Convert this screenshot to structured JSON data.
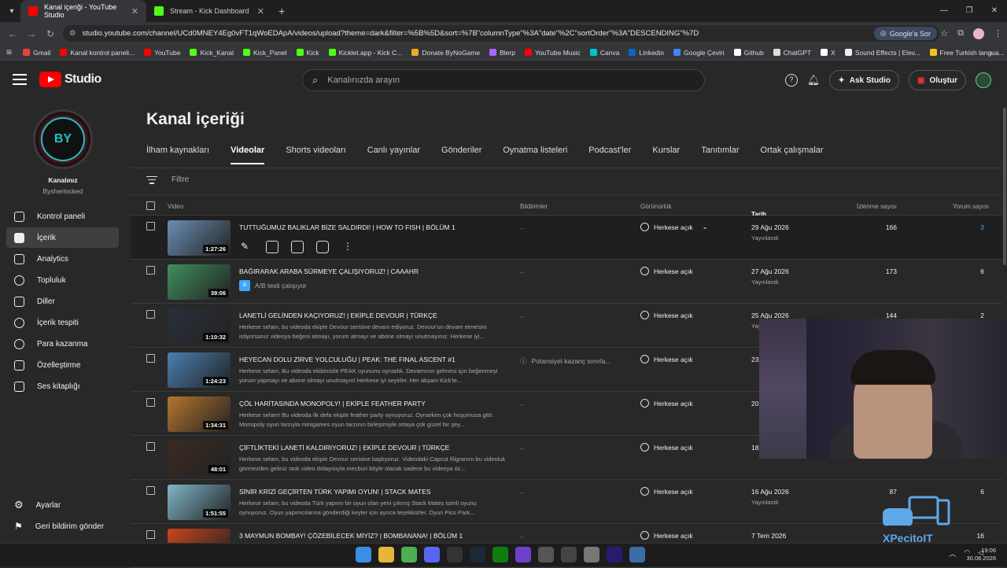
{
  "browser": {
    "tabs": [
      {
        "label": "Kanal içeriği - YouTube Studio",
        "color": "#ff0000"
      },
      {
        "label": "Stream - Kick Dashboard",
        "color": "#53fc18"
      }
    ],
    "url": "studio.youtube.com/channel/UCd0MNEY4Eg0vFT1qWoEDApA/videos/upload?theme=dark&filter=%5B%5D&sort=%7B\"columnType\"%3A\"date\"%2C\"sortOrder\"%3A\"DESCENDING\"%7D",
    "google_ask": "Google'a Sor",
    "bookmarks": [
      {
        "label": "Gmail",
        "color": "#ea4335"
      },
      {
        "label": "Kanal kontrol paneli...",
        "color": "#ff0000"
      },
      {
        "label": "YouTube",
        "color": "#ff0000"
      },
      {
        "label": "Kick_Kanal",
        "color": "#53fc18"
      },
      {
        "label": "Kick_Panel",
        "color": "#53fc18"
      },
      {
        "label": "Kick",
        "color": "#53fc18"
      },
      {
        "label": "Kicklet.app - Kick C...",
        "color": "#53fc18"
      },
      {
        "label": "Donate ByNoGame",
        "color": "#f5a623"
      },
      {
        "label": "Blerp",
        "color": "#aa66ff"
      },
      {
        "label": "YouTube Music",
        "color": "#ff0000"
      },
      {
        "label": "Canva",
        "color": "#00c4cc"
      },
      {
        "label": "Linkedin",
        "color": "#0a66c2"
      },
      {
        "label": "Google Çeviri",
        "color": "#4285f4"
      },
      {
        "label": "Github",
        "color": "#ffffff"
      },
      {
        "label": "ChatGPT",
        "color": "#dddddd"
      },
      {
        "label": "X",
        "color": "#ffffff"
      },
      {
        "label": "Sound Effects | Elev...",
        "color": "#eeeeee"
      },
      {
        "label": "Free Turkish langua...",
        "color": "#f5c518"
      }
    ]
  },
  "header": {
    "logo_text": "Studio",
    "search_placeholder": "Kanalınızda arayın",
    "ask_studio": "Ask Studio",
    "create": "Oluştur"
  },
  "sidebar": {
    "channel_initials": "BY",
    "channel_label": "Kanalınız",
    "channel_handle": "Bysherlocked",
    "items": [
      {
        "label": "Kontrol paneli"
      },
      {
        "label": "İçerik"
      },
      {
        "label": "Analytics"
      },
      {
        "label": "Topluluk"
      },
      {
        "label": "Diller"
      },
      {
        "label": "İçerik tespiti"
      },
      {
        "label": "Para kazanma"
      },
      {
        "label": "Özelleştirme"
      },
      {
        "label": "Ses kitaplığı"
      }
    ],
    "settings": "Ayarlar",
    "feedback": "Geri bildirim gönder"
  },
  "main": {
    "title": "Kanal içeriği",
    "tabs": [
      "İlham kaynakları",
      "Videolar",
      "Shorts videoları",
      "Canlı yayınlar",
      "Gönderiler",
      "Oynatma listeleri",
      "Podcast'ler",
      "Kurslar",
      "Tanıtımlar",
      "Ortak çalışmalar"
    ],
    "filter_placeholder": "Filtre",
    "columns": {
      "video": "Video",
      "notifications": "Bildirimler",
      "visibility": "Görünürlük",
      "date": "Tarih",
      "views": "İzlenme sayısı",
      "comments": "Yorum sayısı"
    },
    "rows": [
      {
        "title": "TUTTUĞUMUZ BALIKLAR BİZE SALDIRDI! | HOW TO FISH | BÖLÜM 1",
        "desc": "",
        "duration": "1:27:26",
        "notif": "–",
        "visibility": "Herkese açık",
        "date": "29 Ağu 2026",
        "status": "Yayınlandı",
        "views": "166",
        "comments": "3",
        "thumb": "#6b8fb5"
      },
      {
        "title": "BAĞIRARAK ARABA SÜRMEYE ÇALIŞIYORUZ! | CAAAHR",
        "desc": "",
        "ab": "A/B testi çalışıyor",
        "duration": "39:06",
        "notif": "–",
        "visibility": "Herkese açık",
        "date": "27 Ağu 2026",
        "status": "Yayınlandı",
        "views": "173",
        "comments": "6",
        "thumb": "#3f8f5e"
      },
      {
        "title": "LANETLİ GELİNDEN KAÇIYORUZ! | EKİPLE DEVOUR | TÜRKÇE",
        "desc": "Herkese selam, bu videoda ekiple Devour serisine devam ediyoruz. Devour'un devam etmesini istiyorsanız videoya beğeni atmayı, yorum atmayı ve abone olmayı unutmayınız. Herkese iyi...",
        "duration": "1:10:32",
        "notif": "–",
        "visibility": "Herkese açık",
        "date": "25 Ağu 2026",
        "status": "Yayınlandı",
        "views": "144",
        "comments": "2",
        "thumb": "#2a2f3a"
      },
      {
        "title": "HEYECAN DOLU ZİRVE YOLCULUĞU | PEAK: THE FINAL ASCENT #1",
        "desc": "Herkese selam, Bu videoda ekibimizle PEAK oyununu oynadık. Devamının gelmesi için beğenmeyi yorum yapmayı ve abone olmayı unutmayın! Herkese iyi seyirler. Her akşam Kick'te...",
        "notif_warn": "Potansiyel kazanç sınırla...",
        "duration": "1:24:23",
        "notif": "",
        "visibility": "Herkese açık",
        "date": "23",
        "status": "",
        "views": "",
        "comments": "",
        "thumb": "#4a7fb0"
      },
      {
        "title": "ÇÖL HARİTASINDA MONOPOLY! | EKİPLE FEATHER PARTY",
        "desc": "Herkese selam! Bu videoda ilk defa ekiple feather party oynuyoruz. Oynarken çok hoşumuza gitti. Monopoly oyun tarzıyla minigames oyun tarzının birleşimiyle ortaya çok güzel bir şey...",
        "duration": "1:34:31",
        "notif": "–",
        "visibility": "Herkese açık",
        "date": "20",
        "status": "",
        "views": "",
        "comments": "",
        "thumb": "#b5762e"
      },
      {
        "title": "ÇİFTLİKTEKİ LANETİ KALDIRIYORUZ! | EKİPLE DEVOUR | TÜRKÇE",
        "desc": "Herkese selam, bu videoda ekiple Devour serisine başlıyoruz. Videodaki Capcut filigranını bu videoluk görmezden geliniz stok video dolayısıyla mecburi böyle olacak sadece bu videoya öz...",
        "duration": "48:01",
        "notif": "–",
        "visibility": "Herkese açık",
        "date": "18",
        "status": "",
        "views": "",
        "comments": "",
        "thumb": "#3b2b22"
      },
      {
        "title": "SİNİR KRİZİ GEÇİRTEN TÜRK YAPIMI OYUN! | STACK MATES",
        "desc": "Herkese selam, bu videoda Türk yapımı bir oyun olan yeni çıkmış Stack Mates isimli oyunu oynuyoruz. Oyun yapımcılarına gönderdiği keyler için ayrıca teşekkürler. Oyun Pico Park...",
        "duration": "1:51:55",
        "notif": "–",
        "visibility": "Herkese açık",
        "date": "16 Ağu 2026",
        "status": "Yayınlandı",
        "views": "87",
        "comments": "6",
        "thumb": "#7fb6c8"
      },
      {
        "title": "3 MAYMUN BOMBAY! ÇÖZEBİLECEK MİYİZ? | BOMBANANA! | BÖLÜM 1",
        "desc": "",
        "duration": "",
        "notif": "–",
        "visibility": "Herkese açık",
        "date": "7 Tem 2026",
        "status": "",
        "views": "",
        "comments": "16",
        "thumb": "#c8451e"
      }
    ]
  },
  "watermark": "XPecitoIT",
  "clock": {
    "time": "19:06",
    "date": "30.08.2026"
  }
}
